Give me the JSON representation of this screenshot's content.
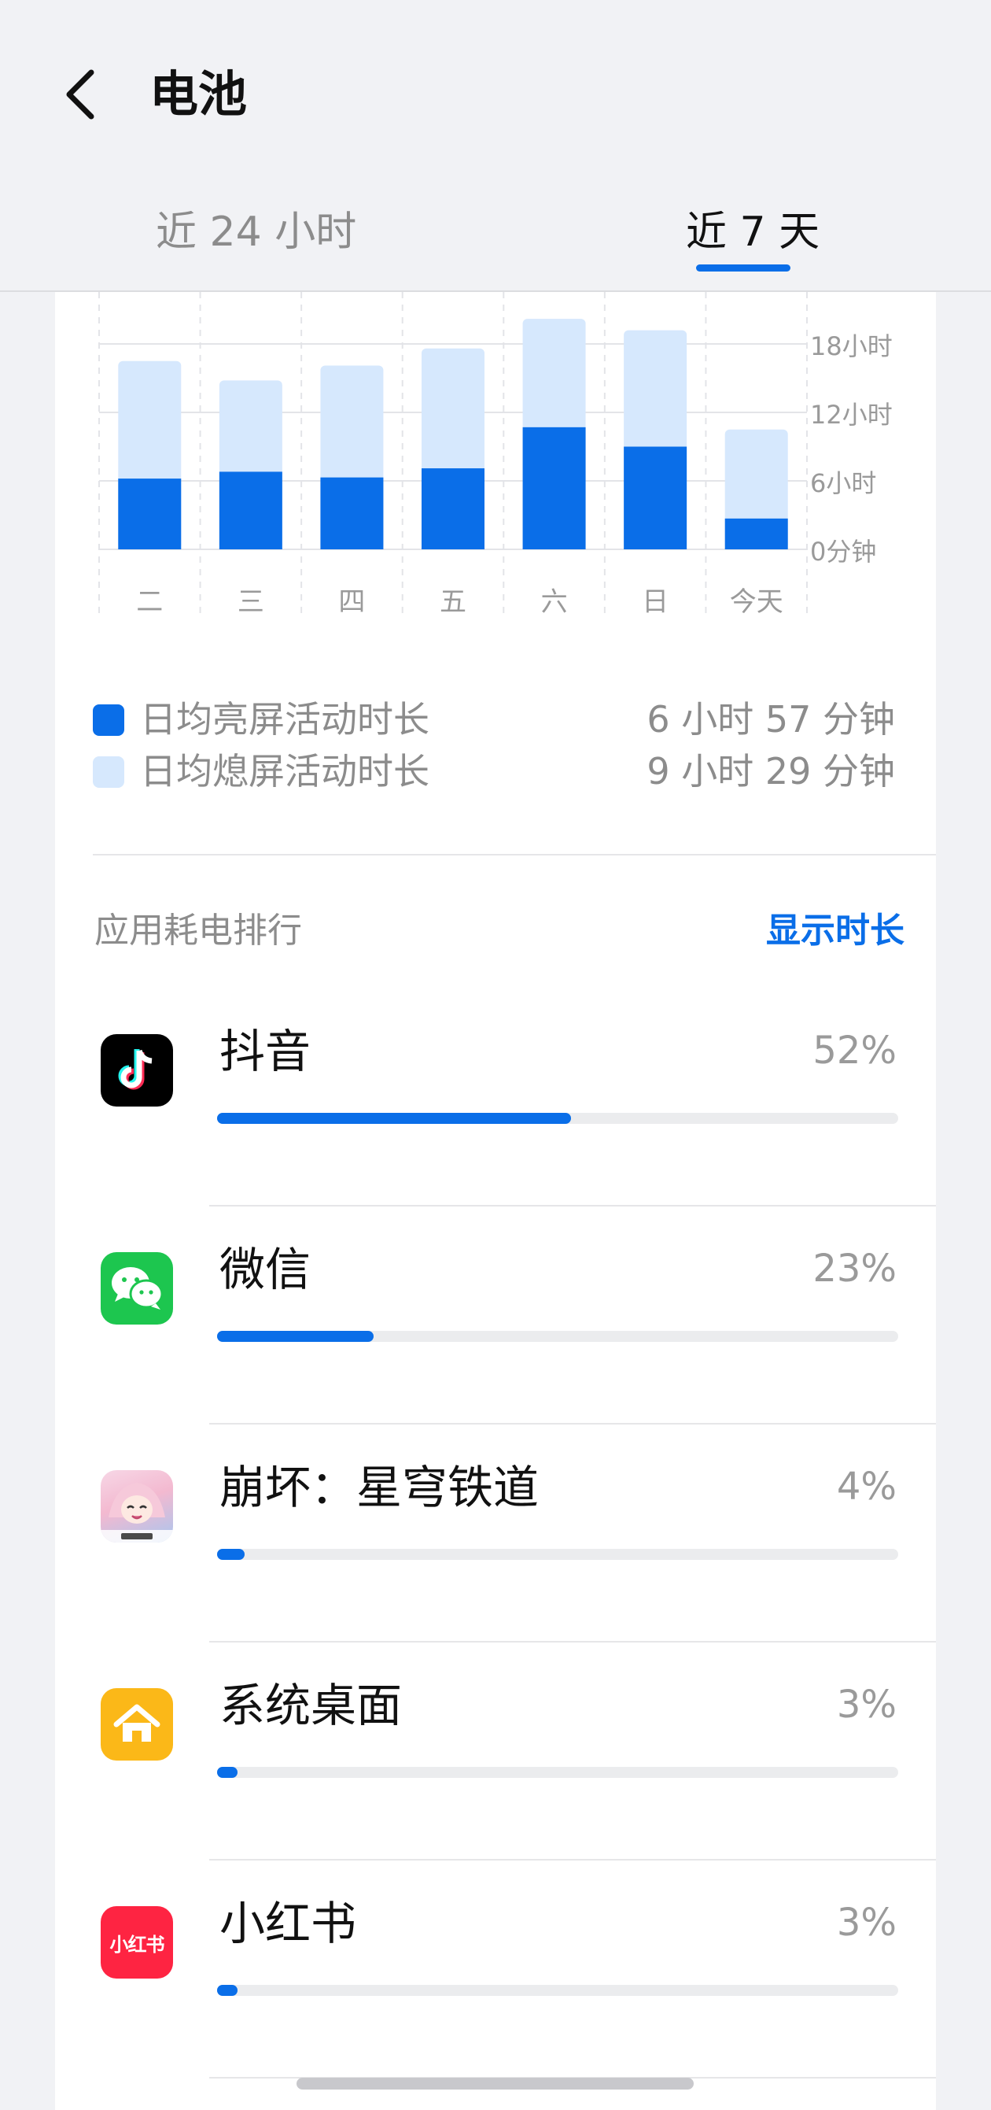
{
  "header": {
    "title": "电池",
    "back_icon": "chevron-left-icon"
  },
  "tabs": [
    {
      "label": "近 24 小时",
      "active": false
    },
    {
      "label": "近 7 天",
      "active": true
    }
  ],
  "chart_data": {
    "type": "bar",
    "stacked": true,
    "categories": [
      "二",
      "三",
      "四",
      "五",
      "六",
      "日",
      "今天"
    ],
    "series": [
      {
        "name": "日均亮屏活动时长",
        "values": [
          6.2,
          6.8,
          6.3,
          7.1,
          10.7,
          9.0,
          2.7
        ],
        "color": "#0a6ee8"
      },
      {
        "name": "日均熄屏活动时长",
        "values": [
          10.3,
          8.0,
          9.8,
          10.5,
          9.5,
          10.2,
          7.8
        ],
        "color": "#d6e8fd"
      }
    ],
    "yticks": [
      "0分钟",
      "6小时",
      "12小时",
      "18小时"
    ],
    "ylim": [
      0,
      20
    ],
    "grid": true
  },
  "legend": [
    {
      "label": "日均亮屏活动时长",
      "value": "6 小时 57 分钟",
      "color": "#0a6ee8"
    },
    {
      "label": "日均熄屏活动时长",
      "value": "9 小时 29 分钟",
      "color": "#d6e8fd"
    }
  ],
  "ranking": {
    "title": "应用耗电排行",
    "toggle_label": "显示时长",
    "apps": [
      {
        "name": "抖音",
        "percent_label": "52%",
        "percent": 52,
        "icon": "douyin-icon"
      },
      {
        "name": "微信",
        "percent_label": "23%",
        "percent": 23,
        "icon": "wechat-icon"
      },
      {
        "name": "崩坏：星穹铁道",
        "percent_label": "4%",
        "percent": 4,
        "icon": "honkai-star-rail-icon"
      },
      {
        "name": "系统桌面",
        "percent_label": "3%",
        "percent": 3,
        "icon": "home-launcher-icon"
      },
      {
        "name": "小红书",
        "percent_label": "3%",
        "percent": 3,
        "icon": "xiaohongshu-icon",
        "icon_text": "小红书"
      }
    ]
  }
}
